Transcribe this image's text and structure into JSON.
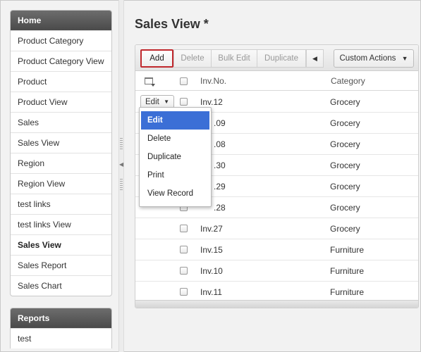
{
  "sidebar": {
    "home_title": "Home",
    "items": [
      {
        "label": "Product Category",
        "active": false
      },
      {
        "label": "Product Category View",
        "active": false
      },
      {
        "label": "Product",
        "active": false
      },
      {
        "label": "Product View",
        "active": false
      },
      {
        "label": "Sales",
        "active": false
      },
      {
        "label": "Sales View",
        "active": false
      },
      {
        "label": "Region",
        "active": false
      },
      {
        "label": "Region View",
        "active": false
      },
      {
        "label": "test links",
        "active": false
      },
      {
        "label": "test links View",
        "active": false
      },
      {
        "label": "Sales View",
        "active": true
      },
      {
        "label": "Sales Report",
        "active": false
      },
      {
        "label": "Sales Chart",
        "active": false
      }
    ],
    "reports_title": "Reports",
    "reports_items": [
      {
        "label": "test"
      }
    ]
  },
  "page": {
    "title": "Sales View *"
  },
  "toolbar": {
    "add": "Add",
    "delete": "Delete",
    "bulk_edit": "Bulk Edit",
    "duplicate": "Duplicate",
    "collapse_arrow": "◀",
    "custom_actions": "Custom Actions",
    "custom_caret": "▼"
  },
  "table": {
    "columns": {
      "invno": "Inv.No.",
      "category": "Category"
    },
    "rows": [
      {
        "invno": "Inv.12",
        "category": "Grocery"
      },
      {
        "invno": ".09",
        "category": "Grocery"
      },
      {
        "invno": ".08",
        "category": "Grocery"
      },
      {
        "invno": ".30",
        "category": "Grocery"
      },
      {
        "invno": ".29",
        "category": "Grocery"
      },
      {
        "invno": ".28",
        "category": "Grocery"
      },
      {
        "invno": "Inv.27",
        "category": "Grocery"
      },
      {
        "invno": "Inv.15",
        "category": "Furniture"
      },
      {
        "invno": "Inv.10",
        "category": "Furniture"
      },
      {
        "invno": "Inv.11",
        "category": "Furniture"
      }
    ],
    "edit_button": "Edit",
    "edit_caret": "▼"
  },
  "menu": {
    "items": [
      "Edit",
      "Delete",
      "Duplicate",
      "Print",
      "View Record"
    ],
    "highlighted_index": 0
  },
  "colors": {
    "sidebar_header": "#4a4a4a",
    "add_border": "#c0282d",
    "menu_highlight": "#3b6fd6"
  }
}
